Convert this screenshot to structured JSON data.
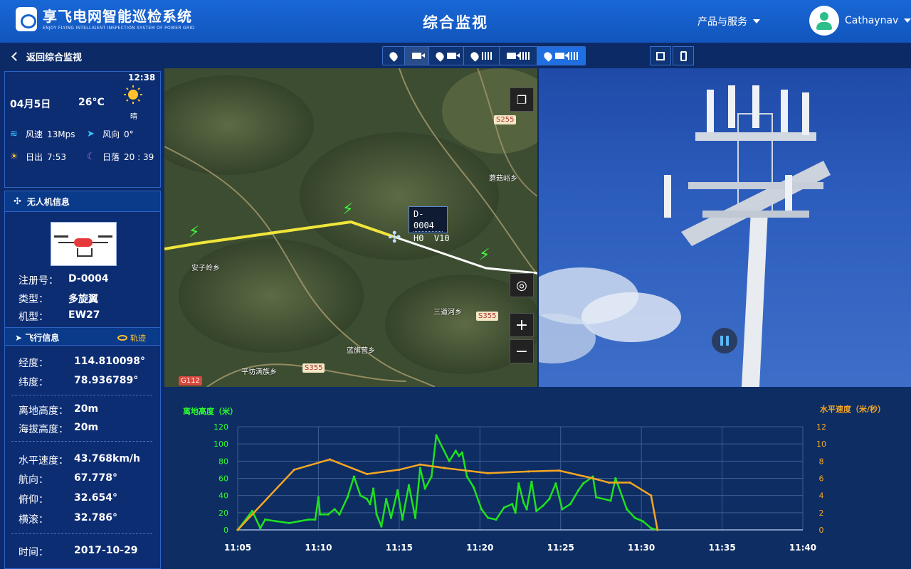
{
  "header": {
    "app_name": "电网智能巡检系统",
    "brand_mark": "享飞",
    "brand_sub": "ENJOY FLYING    INTELLIGENT INSPECTION SYSTEM OF POWER GRID",
    "page_title": "综合监视",
    "products_menu": "产品与服务",
    "user_name": "Cathaynav"
  },
  "subbar": {
    "back_label": "返回综合监视",
    "view_modes": [
      {
        "icons": [
          "map-pin-icon"
        ],
        "state": "off"
      },
      {
        "icons": [
          "video-camera-icon"
        ],
        "state": "selected"
      },
      {
        "icons": [
          "map-pin-icon",
          "video-camera-icon"
        ],
        "state": "off"
      },
      {
        "icons": [
          "map-pin-icon",
          "bar-chart-icon"
        ],
        "state": "off"
      },
      {
        "icons": [
          "video-camera-icon",
          "bar-chart-icon"
        ],
        "state": "off"
      },
      {
        "icons": [
          "map-pin-icon",
          "video-camera-icon",
          "bar-chart-icon"
        ],
        "state": "active"
      }
    ]
  },
  "weather": {
    "time": "12:38",
    "date": "04月5日",
    "temperature": "26°C",
    "condition": "晴",
    "wind_speed_label": "风速",
    "wind_speed": "13Mps",
    "wind_dir_label": "风向",
    "wind_dir": "0°",
    "sunrise_label": "日出",
    "sunrise": "7:53",
    "sunset_label": "日落",
    "sunset": "20 : 39"
  },
  "drone": {
    "panel_title": "无人机信息",
    "reg_label": "注册号：",
    "reg_value": "D-0004",
    "type_label": "类型：",
    "type_value": "多旋翼",
    "model_label": "机型：",
    "model_value": "EW27"
  },
  "flight": {
    "title": "飞行信息",
    "track_label": "轨迹",
    "rows": [
      {
        "label": "经度：",
        "value": "114.810098°"
      },
      {
        "label": "纬度：",
        "value": "78.936789°"
      },
      {
        "label": "离地高度：",
        "value": "20m"
      },
      {
        "label": "海拔高度：",
        "value": "20m"
      },
      {
        "label": "水平速度：",
        "value": "43.768km/h"
      },
      {
        "label": "航向：",
        "value": "67.778°"
      },
      {
        "label": "俯仰：",
        "value": "32.654°"
      },
      {
        "label": "横滚：",
        "value": "32.786°"
      },
      {
        "label": "时间：",
        "value": "2017-10-29"
      }
    ]
  },
  "map": {
    "drone_id": "D-0004",
    "drone_hv": "H0  V10",
    "road_labels": [
      "S255",
      "S355",
      "S355",
      "G112"
    ],
    "places": [
      "安子岭乡",
      "蘑菇峪乡",
      "三道河乡",
      "蓝旗营乡",
      "平坊满族乡"
    ],
    "zoom_in": "+",
    "zoom_out": "−"
  },
  "chart_data": {
    "type": "line",
    "x": [
      "11:05",
      "11:10",
      "11:15",
      "11:20",
      "11:25",
      "11:30",
      "11:35",
      "11:40"
    ],
    "left_axis": {
      "label": "离地高度（米）",
      "ticks": [
        0,
        20,
        40,
        60,
        80,
        100,
        120
      ],
      "color": "#2cff2c"
    },
    "right_axis": {
      "label": "水平速度（米/秒）",
      "ticks": [
        0,
        2,
        4,
        6,
        8,
        10,
        12
      ],
      "color": "#f5a623"
    },
    "series": [
      {
        "name": "离地高度（米）",
        "axis": "left",
        "color": "#1fe21f",
        "points": [
          [
            0,
            0
          ],
          [
            0.9,
            22
          ],
          [
            1.4,
            2
          ],
          [
            1.7,
            12
          ],
          [
            2.4,
            10
          ],
          [
            3.2,
            8
          ],
          [
            3.8,
            10
          ],
          [
            4.4,
            12
          ],
          [
            4.8,
            12
          ],
          [
            5.0,
            38
          ],
          [
            5.1,
            18
          ],
          [
            5.6,
            18
          ],
          [
            6.0,
            24
          ],
          [
            6.3,
            18
          ],
          [
            6.8,
            38
          ],
          [
            7.2,
            62
          ],
          [
            7.6,
            40
          ],
          [
            8.0,
            36
          ],
          [
            8.2,
            30
          ],
          [
            8.4,
            48
          ],
          [
            8.6,
            18
          ],
          [
            8.9,
            4
          ],
          [
            9.2,
            36
          ],
          [
            9.5,
            14
          ],
          [
            9.9,
            46
          ],
          [
            10.2,
            12
          ],
          [
            10.6,
            52
          ],
          [
            11.0,
            14
          ],
          [
            11.3,
            72
          ],
          [
            11.6,
            48
          ],
          [
            12.0,
            62
          ],
          [
            12.3,
            110
          ],
          [
            13.1,
            80
          ],
          [
            13.5,
            92
          ],
          [
            13.7,
            86
          ],
          [
            13.9,
            90
          ],
          [
            14.2,
            62
          ],
          [
            14.6,
            50
          ],
          [
            15.1,
            24
          ],
          [
            15.5,
            14
          ],
          [
            16.0,
            12
          ],
          [
            16.5,
            26
          ],
          [
            17.0,
            30
          ],
          [
            17.2,
            20
          ],
          [
            17.4,
            54
          ],
          [
            17.7,
            32
          ],
          [
            17.9,
            24
          ],
          [
            18.2,
            56
          ],
          [
            18.5,
            22
          ],
          [
            18.9,
            28
          ],
          [
            19.3,
            36
          ],
          [
            19.7,
            54
          ],
          [
            20.1,
            24
          ],
          [
            20.6,
            30
          ],
          [
            21.1,
            46
          ],
          [
            21.4,
            54
          ],
          [
            22.0,
            62
          ],
          [
            22.2,
            38
          ],
          [
            23.1,
            34
          ],
          [
            23.4,
            60
          ],
          [
            24.1,
            24
          ],
          [
            24.6,
            14
          ],
          [
            25.1,
            10
          ],
          [
            25.6,
            2
          ],
          [
            26.0,
            0
          ]
        ]
      },
      {
        "name": "水平速度（米/秒）",
        "axis": "right",
        "color": "#f5a623",
        "points": [
          [
            0,
            0
          ],
          [
            3.5,
            7
          ],
          [
            5.7,
            8.2
          ],
          [
            8.0,
            6.5
          ],
          [
            10.0,
            7
          ],
          [
            11.3,
            7.6
          ],
          [
            12.8,
            7.2
          ],
          [
            15.5,
            6.6
          ],
          [
            18.0,
            6.8
          ],
          [
            19.9,
            6.9
          ],
          [
            22.0,
            6.0
          ],
          [
            23.0,
            5.5
          ],
          [
            24.3,
            5.5
          ],
          [
            25.6,
            4.0
          ],
          [
            26.0,
            0
          ]
        ]
      }
    ],
    "x_range_minutes": [
      0,
      35
    ],
    "ylim_left": [
      0,
      120
    ],
    "ylim_right": [
      0,
      12
    ],
    "grid": true
  },
  "colors": {
    "header_bg": "#1867d6",
    "panel_bg": "#0d2d73",
    "accent": "#ffc22e",
    "chart_altitude": "#1fe21f",
    "chart_speed": "#f5a623"
  }
}
